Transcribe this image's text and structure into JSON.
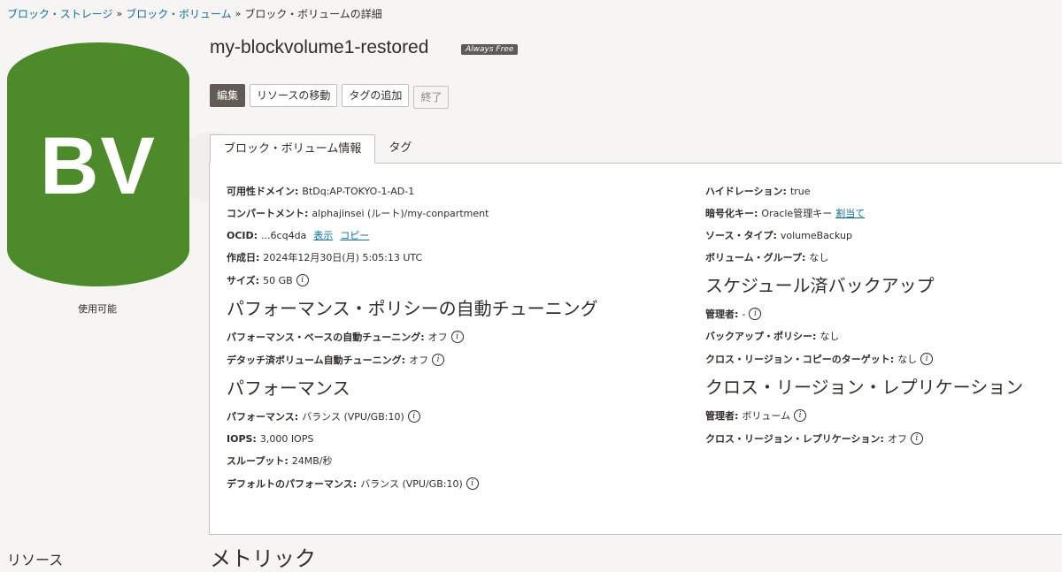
{
  "breadcrumb": {
    "item1": "ブロック・ストレージ",
    "item2": "ブロック・ボリューム",
    "current": "ブロック・ボリュームの詳細",
    "sep": "»"
  },
  "badge": {
    "text": "BV",
    "color": "#4c8a2a"
  },
  "status": "使用可能",
  "left_resource": "リソース",
  "title": "my-blockvolume1-restored",
  "always_free": "Always Free",
  "actions": {
    "edit": "編集",
    "move": "リソースの移動",
    "add_tag": "タグの追加",
    "terminate": "終了"
  },
  "tabs": {
    "info": "ブロック・ボリューム情報",
    "tags": "タグ"
  },
  "left": {
    "ad": {
      "label": "可用性ドメイン:",
      "value": "BtDq:AP-TOKYO-1-AD-1"
    },
    "compartment": {
      "label": "コンパートメント:",
      "value": "alphajinsei (ルート)/my-conpartment"
    },
    "ocid": {
      "label": "OCID:",
      "value": "...6cq4da",
      "show": "表示",
      "copy": "コピー"
    },
    "created": {
      "label": "作成日:",
      "value": "2024年12月30日(月) 5:05:13 UTC"
    },
    "size": {
      "label": "サイズ:",
      "value": "50 GB"
    },
    "autotune_heading": "パフォーマンス・ポリシーの自動チューニング",
    "perf_autotune": {
      "label": "パフォーマンス・ベースの自動チューニング:",
      "value": "オフ"
    },
    "detached_autotune": {
      "label": "デタッチ済ボリューム自動チューニング:",
      "value": "オフ"
    },
    "perf_heading": "パフォーマンス",
    "performance": {
      "label": "パフォーマンス:",
      "value": "バランス (VPU/GB:10)"
    },
    "iops": {
      "label": "IOPS:",
      "value": "3,000 IOPS"
    },
    "throughput": {
      "label": "スループット:",
      "value": "24MB/秒"
    },
    "default_perf": {
      "label": "デフォルトのパフォーマンス:",
      "value": "バランス (VPU/GB:10)"
    }
  },
  "right": {
    "hydration": {
      "label": "ハイドレーション:",
      "value": "true"
    },
    "encryption": {
      "label": "暗号化キー:",
      "value": "Oracle管理キー",
      "link": "割当て"
    },
    "source_type": {
      "label": "ソース・タイプ:",
      "value": "volumeBackup"
    },
    "volume_group": {
      "label": "ボリューム・グループ:",
      "value": "なし"
    },
    "backup_heading": "スケジュール済バックアップ",
    "admin1": {
      "label": "管理者:",
      "value": "-"
    },
    "backup_policy": {
      "label": "バックアップ・ポリシー:",
      "value": "なし"
    },
    "cross_copy": {
      "label": "クロス・リージョン・コピーのターゲット:",
      "value": "なし"
    },
    "replication_heading": "クロス・リージョン・レプリケーション",
    "admin2": {
      "label": "管理者:",
      "value": "ボリューム"
    },
    "replication": {
      "label": "クロス・リージョン・レプリケーション:",
      "value": "オフ"
    }
  },
  "metrics_title": "メトリック",
  "icons": {
    "info": "i"
  }
}
